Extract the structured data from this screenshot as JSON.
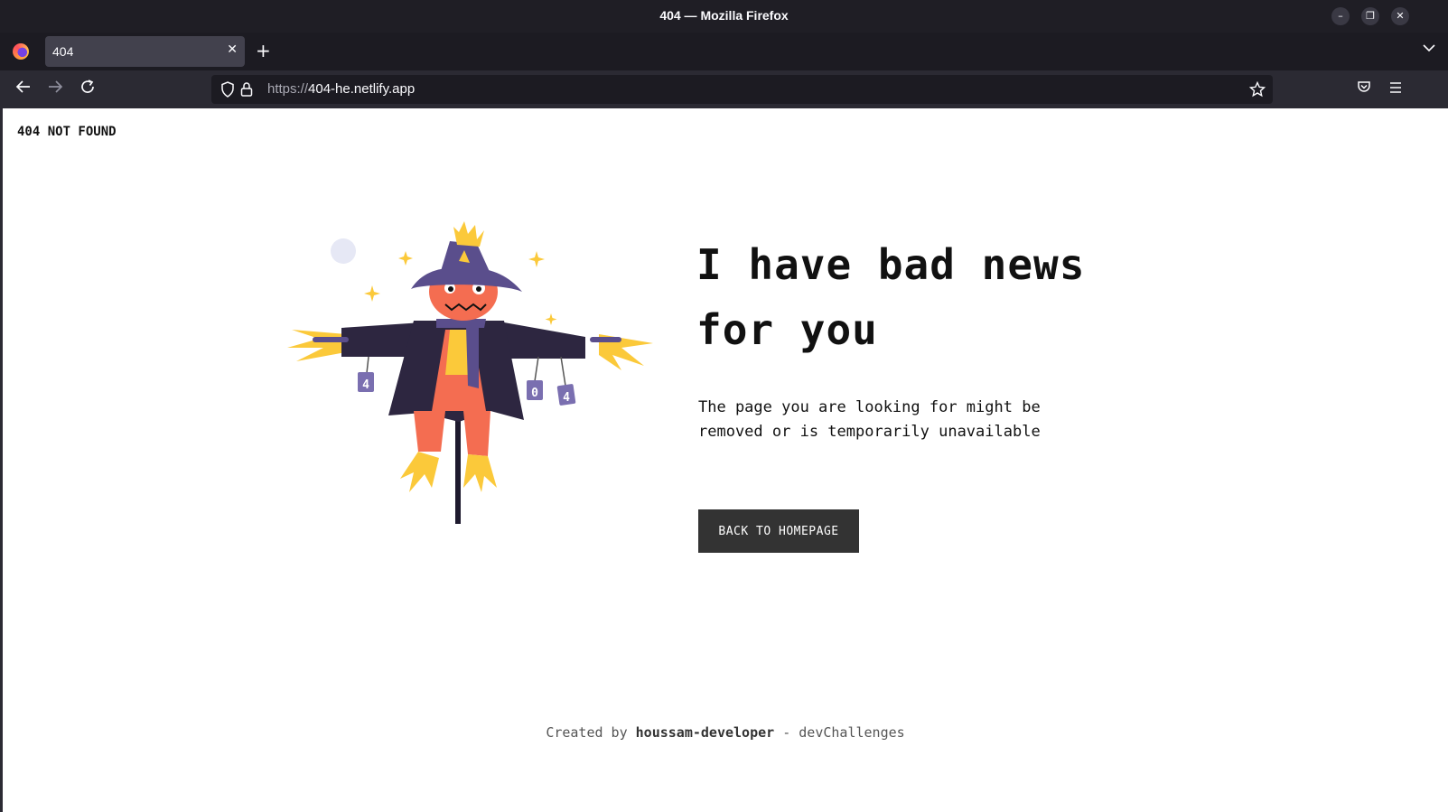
{
  "window": {
    "title": "404 — Mozilla Firefox",
    "minimize_icon": "minimize-icon",
    "restore_icon": "restore-icon",
    "close_icon": "close-icon"
  },
  "tabs": [
    {
      "label": "404",
      "active": true
    }
  ],
  "navbar": {
    "url_protocol": "https://",
    "url_host": "404-he.netlify.app"
  },
  "page": {
    "brand": "404 NOT FOUND",
    "headline": "I have bad news for you",
    "description": "The page you are looking for might be removed or is temporarily unavailable",
    "button_label": "BACK TO HOMEPAGE",
    "footer_prefix": "Created by",
    "footer_author": "houssam-developer",
    "footer_suffix": "- devChallenges",
    "can_labels": [
      "4",
      "0",
      "4"
    ]
  },
  "colors": {
    "accent_dark": "#333333",
    "scarecrow_coat": "#2d2640",
    "scarecrow_hat": "#5a4e8c",
    "scarecrow_face": "#f46d51",
    "straw": "#fbc93a"
  }
}
